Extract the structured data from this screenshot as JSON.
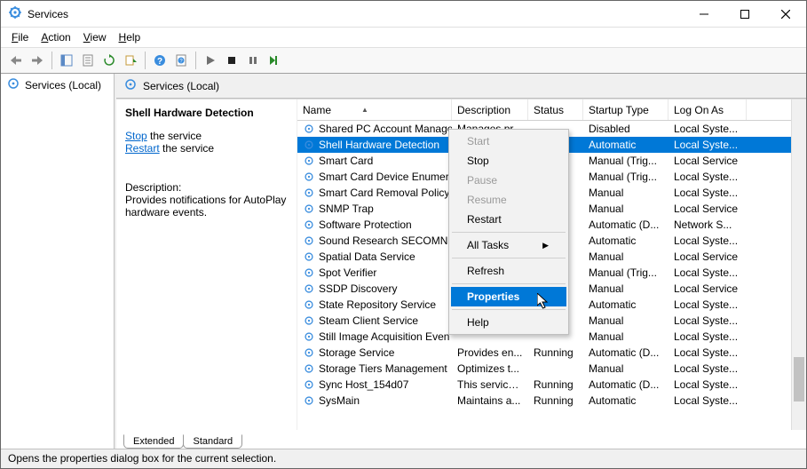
{
  "window": {
    "title": "Services"
  },
  "menus": {
    "file": "File",
    "action": "Action",
    "view": "View",
    "help": "Help"
  },
  "left_pane": {
    "root_label": "Services (Local)"
  },
  "right_header": "Services (Local)",
  "detail": {
    "service_name": "Shell Hardware Detection",
    "stop_link": "Stop",
    "stop_suffix": " the service",
    "restart_link": "Restart",
    "restart_suffix": " the service",
    "description_label": "Description:",
    "description_text": "Provides notifications for AutoPlay hardware events."
  },
  "columns": {
    "name": "Name",
    "description": "Description",
    "status": "Status",
    "startup": "Startup Type",
    "logon": "Log On As"
  },
  "rows": [
    {
      "name": "Shared PC Account Manager",
      "desc": "Manages pr...",
      "status": "",
      "startup": "Disabled",
      "logon": "Local Syste..."
    },
    {
      "name": "Shell Hardware Detection",
      "desc": "",
      "status": "",
      "startup": "Automatic",
      "logon": "Local Syste...",
      "selected": true
    },
    {
      "name": "Smart Card",
      "desc": "",
      "status": "",
      "startup": "Manual (Trig...",
      "logon": "Local Service"
    },
    {
      "name": "Smart Card Device Enumer",
      "desc": "",
      "status": "",
      "startup": "Manual (Trig...",
      "logon": "Local Syste..."
    },
    {
      "name": "Smart Card Removal Policy",
      "desc": "",
      "status": "",
      "startup": "Manual",
      "logon": "Local Syste..."
    },
    {
      "name": "SNMP Trap",
      "desc": "",
      "status": "",
      "startup": "Manual",
      "logon": "Local Service"
    },
    {
      "name": "Software Protection",
      "desc": "",
      "status": "",
      "startup": "Automatic (D...",
      "logon": "Network S..."
    },
    {
      "name": "Sound Research SECOMN S",
      "desc": "",
      "status": "",
      "startup": "Automatic",
      "logon": "Local Syste..."
    },
    {
      "name": "Spatial Data Service",
      "desc": "",
      "status": "",
      "startup": "Manual",
      "logon": "Local Service"
    },
    {
      "name": "Spot Verifier",
      "desc": "",
      "status": "",
      "startup": "Manual (Trig...",
      "logon": "Local Syste..."
    },
    {
      "name": "SSDP Discovery",
      "desc": "",
      "status": "",
      "startup": "Manual",
      "logon": "Local Service"
    },
    {
      "name": "State Repository Service",
      "desc": "",
      "status": "",
      "startup": "Automatic",
      "logon": "Local Syste..."
    },
    {
      "name": "Steam Client Service",
      "desc": "",
      "status": "",
      "startup": "Manual",
      "logon": "Local Syste..."
    },
    {
      "name": "Still Image Acquisition Even",
      "desc": "",
      "status": "",
      "startup": "Manual",
      "logon": "Local Syste..."
    },
    {
      "name": "Storage Service",
      "desc": "Provides en...",
      "status": "Running",
      "startup": "Automatic (D...",
      "logon": "Local Syste..."
    },
    {
      "name": "Storage Tiers Management",
      "desc": "Optimizes t...",
      "status": "",
      "startup": "Manual",
      "logon": "Local Syste..."
    },
    {
      "name": "Sync Host_154d07",
      "desc": "This service ...",
      "status": "Running",
      "startup": "Automatic (D...",
      "logon": "Local Syste..."
    },
    {
      "name": "SysMain",
      "desc": "Maintains a...",
      "status": "Running",
      "startup": "Automatic",
      "logon": "Local Syste..."
    }
  ],
  "tabs": {
    "extended": "Extended",
    "standard": "Standard"
  },
  "context_menu": {
    "start": "Start",
    "stop": "Stop",
    "pause": "Pause",
    "resume": "Resume",
    "restart": "Restart",
    "all_tasks": "All Tasks",
    "refresh": "Refresh",
    "properties": "Properties",
    "help": "Help"
  },
  "statusbar": "Opens the properties dialog box for the current selection."
}
